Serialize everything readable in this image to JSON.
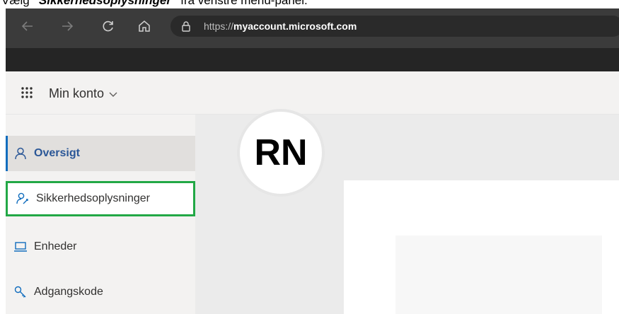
{
  "instruction": {
    "prefix": "Vælg ",
    "emphasis": "“Sikkerhedsoplysninger”",
    "suffix": " fra venstre menu-panel."
  },
  "browser": {
    "url_prefix": "https://",
    "url_host": "myaccount.microsoft.com",
    "icons": [
      "back-icon",
      "forward-icon",
      "refresh-icon",
      "home-icon",
      "lock-icon"
    ]
  },
  "header": {
    "app_title": "Min konto",
    "icons": [
      "app-launcher-icon",
      "chevron-down-icon"
    ]
  },
  "sidebar": {
    "items": [
      {
        "label": "Oversigt",
        "icon": "person-icon",
        "state": "active"
      },
      {
        "label": "Sikkerhedsoplysninger",
        "icon": "person-key-icon",
        "state": "highlighted"
      },
      {
        "label": "Enheder",
        "icon": "laptop-icon",
        "state": "normal"
      },
      {
        "label": "Adgangskode",
        "icon": "key-icon",
        "state": "normal"
      }
    ]
  },
  "profile": {
    "initials": "RN"
  },
  "colors": {
    "accent": "#0f6cbd",
    "active_text": "#2b5797",
    "highlight_border": "#22a846",
    "browser_bg": "#3b3b3b"
  }
}
